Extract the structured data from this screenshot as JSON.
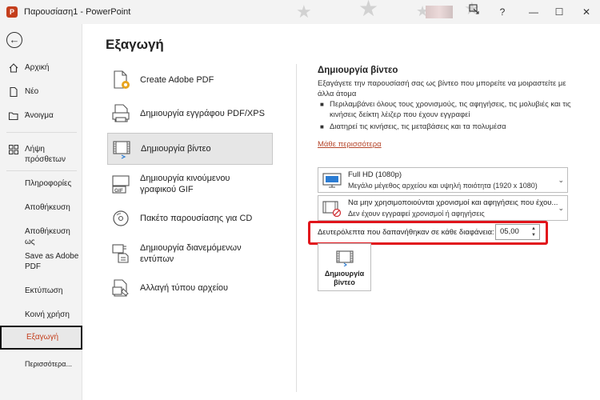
{
  "window": {
    "app_icon_letter": "P",
    "doc_title": "Παρουσίαση1  -  PowerPoint",
    "help_label": "?",
    "minimize_label": "—",
    "maximize_label": "☐",
    "close_label": "✕"
  },
  "nav": {
    "back_label": "←",
    "items": [
      {
        "label": "Αρχική"
      },
      {
        "label": "Νέο"
      },
      {
        "label": "Άνοιγμα"
      },
      {
        "label": "Λήψη πρόσθετων"
      },
      {
        "label": "Πληροφορίες"
      },
      {
        "label": "Αποθήκευση"
      },
      {
        "label": "Αποθήκευση ως"
      },
      {
        "label": "Save as Adobe PDF"
      },
      {
        "label": "Εκτύπωση"
      },
      {
        "label": "Κοινή χρήση"
      },
      {
        "label": "Εξαγωγή"
      },
      {
        "label": "Περισσότερα..."
      }
    ],
    "active_color": "#c43e1c"
  },
  "main": {
    "title": "Εξαγωγή",
    "options": [
      {
        "label": "Create Adobe PDF"
      },
      {
        "label": "Δημιουργία εγγράφου PDF/XPS"
      },
      {
        "label": "Δημιουργία βίντεο"
      },
      {
        "label": "Δημιουργία κινούμενου γραφικού GIF"
      },
      {
        "label": "Πακέτο παρουσίασης για CD"
      },
      {
        "label": "Δημιουργία διανεμόμενων εντύπων"
      },
      {
        "label": "Αλλαγή τύπου αρχείου"
      }
    ],
    "gif_badge": "GIF"
  },
  "panel": {
    "title": "Δημιουργία βίντεο",
    "description": "Εξαγάγετε την παρουσίασή σας ως βίντεο που μπορείτε να μοιραστείτε με άλλα άτομα",
    "bullet_char": "■",
    "bullets": [
      "Περιλαμβάνει όλους τους χρονισμούς, τις αφηγήσεις, τις μολυβιές και τις κινήσεις δείκτη λέιζερ που έχουν εγγραφεί",
      "Διατηρεί τις κινήσεις, τις μεταβάσεις και τα πολυμέσα"
    ],
    "learn_more": "Μάθε περισσότερα",
    "quality": {
      "title": "Full HD (1080p)",
      "subtitle": "Μεγάλο μέγεθος αρχείου και υψηλή ποιότητα (1920 x 1080)"
    },
    "timings": {
      "title": "Να μην χρησιμοποιούνται χρονισμοί και αφηγήσεις που έχου...",
      "subtitle": "Δεν έχουν εγγραφεί χρονισμοί ή αφηγήσεις"
    },
    "chevron": "⌄",
    "seconds_label": "Δευτερόλεπτα που δαπανήθηκαν σε κάθε διαφάνεια:",
    "seconds_value": "05,00",
    "spin_up": "▲",
    "spin_down": "▼",
    "create_button": "Δημιουργία βίντεο",
    "highlight_color": "#e1141b",
    "link_color": "#b5452a"
  }
}
